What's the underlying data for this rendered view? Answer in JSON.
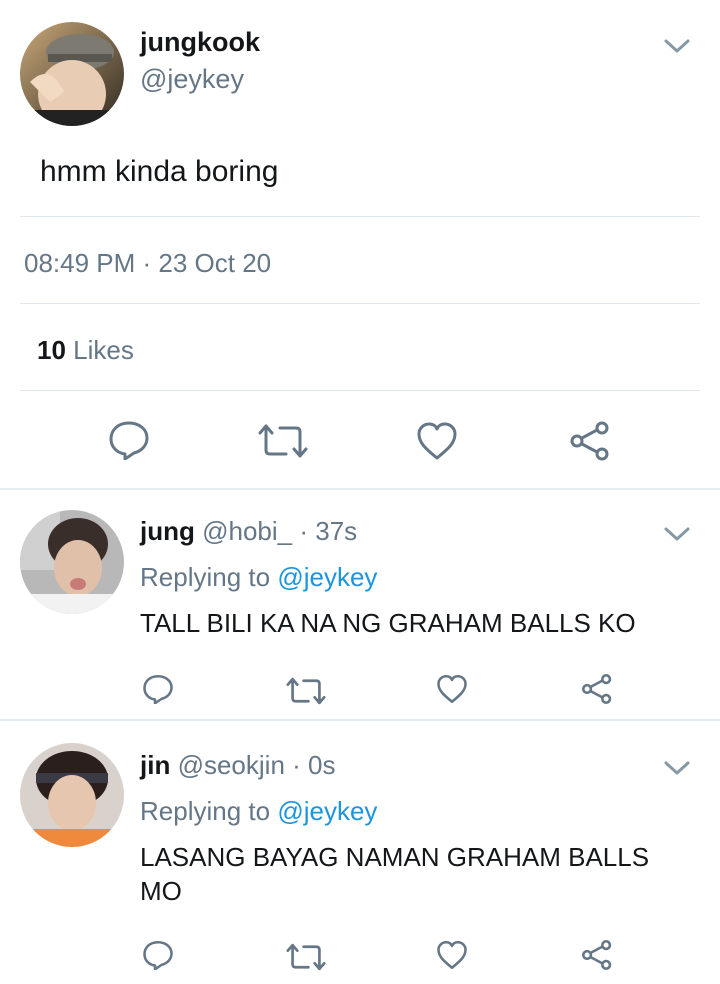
{
  "main_tweet": {
    "name": "jungkook",
    "handle": "@jeykey",
    "text": "hmm kinda boring",
    "timestamp": "08:49 PM · 23 Oct 20",
    "likes_count": "10",
    "likes_label": "Likes"
  },
  "replies": [
    {
      "name": "jung",
      "handle": "@hobi_",
      "time": "· 37s",
      "replying_label": "Replying to",
      "replying_to": "@jeykey",
      "text": "TALL BILI KA NA NG GRAHAM BALLS KO"
    },
    {
      "name": "jin",
      "handle": "@seokjin",
      "time": "· 0s",
      "replying_label": "Replying to",
      "replying_to": "@jeykey",
      "text_line1": "LASANG BAYAG NAMAN GRAHAM BALLS",
      "text_line2": "MO"
    }
  ],
  "colors": {
    "text": "#14171a",
    "secondary": "#657786",
    "link": "#1b95e0",
    "divider": "#e1e8ed"
  },
  "icons": [
    "reply-icon",
    "retweet-icon",
    "like-icon",
    "share-icon",
    "chevron-down-icon"
  ]
}
